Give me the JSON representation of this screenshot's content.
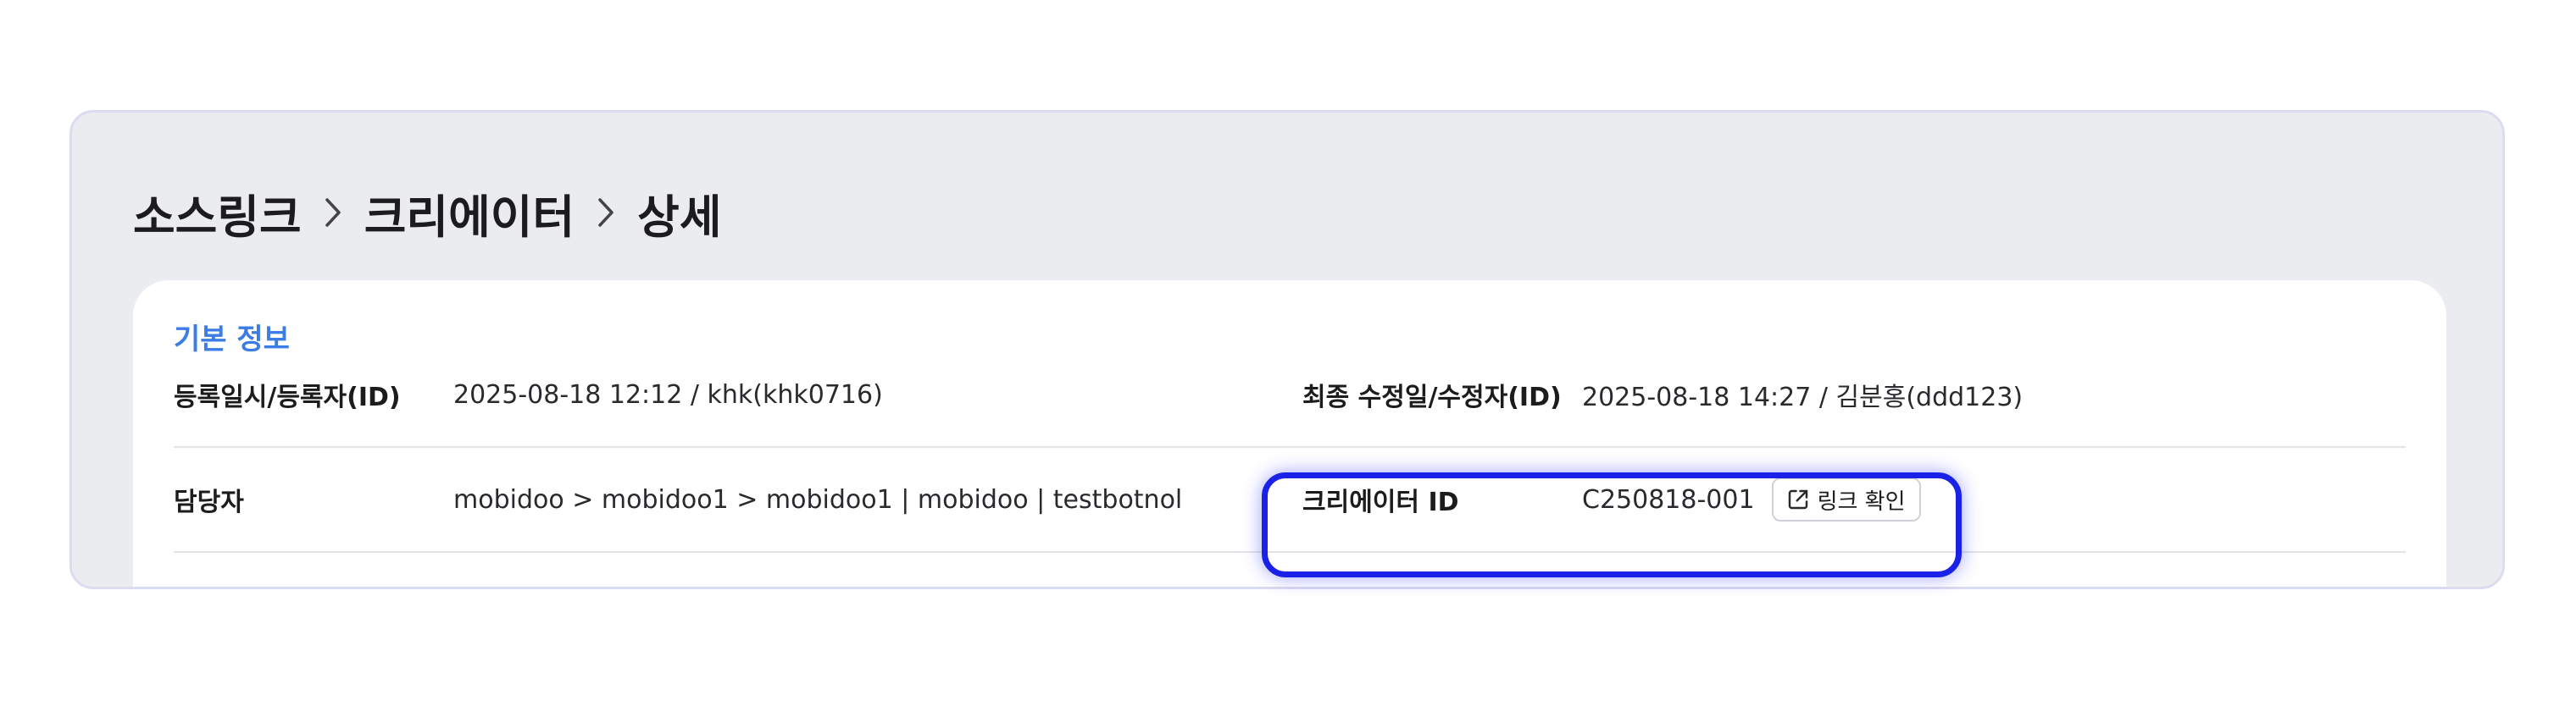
{
  "breadcrumb": {
    "items": [
      "소스링크",
      "크리에이터",
      "상세"
    ]
  },
  "section": {
    "title": "기본 정보"
  },
  "fields": {
    "registered_label": "등록일시/등록자(ID)",
    "registered_value": "2025-08-18 12:12 / khk(khk0716)",
    "modified_label": "최종 수정일/수정자(ID)",
    "modified_value": "2025-08-18 14:27 / 김분홍(ddd123)",
    "manager_label": "담당자",
    "manager_value": "mobidoo > mobidoo1 > mobidoo1 | mobidoo | testbotnol",
    "creator_id_label": "크리에이터 ID",
    "creator_id_value": "C250818-001",
    "link_button_label": "링크 확인"
  },
  "icons": {
    "separator": "chevron-right-icon",
    "link": "external-link-icon"
  },
  "colors": {
    "section_title": "#3b7de4",
    "highlight_border": "#1a22e8",
    "panel_bg": "#ebecf0"
  }
}
